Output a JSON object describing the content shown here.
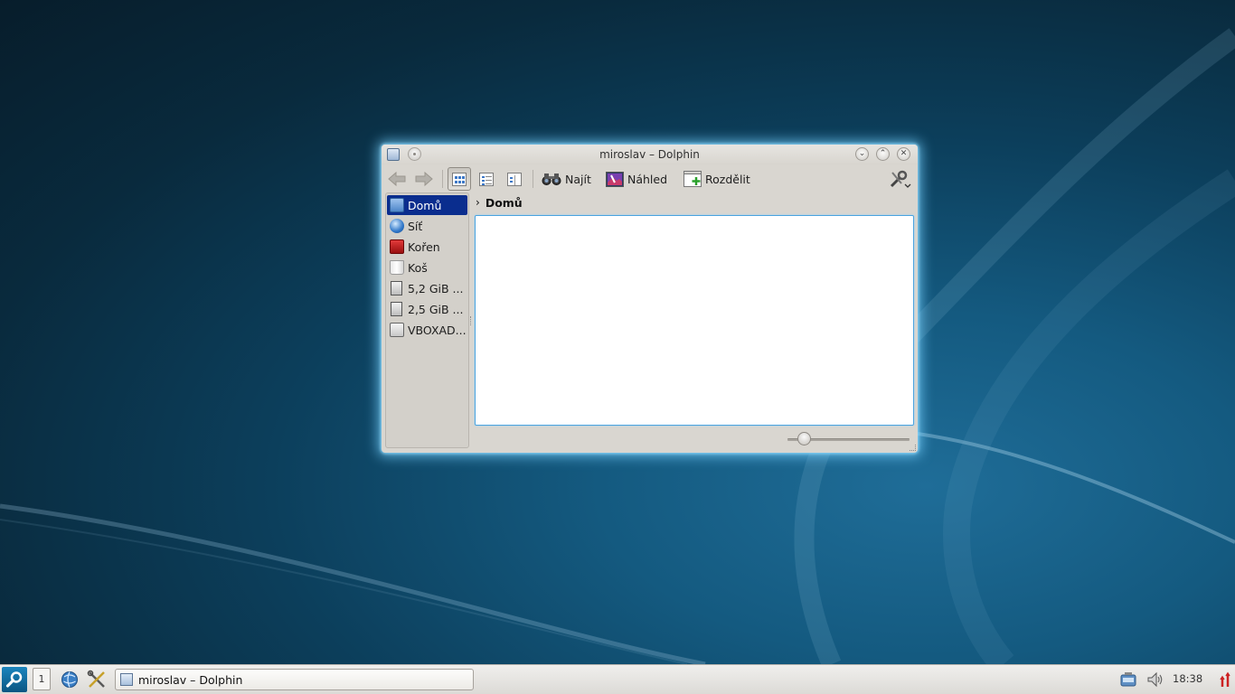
{
  "window": {
    "title": "miroslav – Dolphin",
    "buttons": {
      "minimize": "⌄",
      "maximize": "⌃",
      "close": "✕"
    }
  },
  "toolbar": {
    "back_icon": "arrow-left-icon",
    "forward_icon": "arrow-right-icon",
    "view_modes": [
      "icons-view-icon",
      "details-view-icon",
      "columns-view-icon"
    ],
    "active_view_mode": 0,
    "find_label": "Najít",
    "preview_label": "Náhled",
    "split_label": "Rozdělit",
    "settings_icon": "wrench-screwdriver-icon"
  },
  "places": [
    {
      "label": "Domů",
      "icon": "home-folder-icon",
      "selected": true
    },
    {
      "label": "Síť",
      "icon": "network-globe-icon",
      "selected": false
    },
    {
      "label": "Kořen",
      "icon": "root-folder-icon",
      "selected": false
    },
    {
      "label": "Koš",
      "icon": "trash-icon",
      "selected": false
    },
    {
      "label": "5,2 GiB ...",
      "icon": "hard-drive-icon",
      "selected": false
    },
    {
      "label": "2,5 GiB ...",
      "icon": "hard-drive-icon",
      "selected": false
    },
    {
      "label": "VBOXAD...",
      "icon": "optical-disc-icon",
      "selected": false
    }
  ],
  "breadcrumb": {
    "current": "Domů"
  },
  "zoom_level_fraction": 0.14,
  "taskbar": {
    "desktop_number": "1",
    "task_title": "miroslav – Dolphin",
    "clock": "18:38"
  },
  "colors": {
    "selection": "#0a2d8e",
    "window_glow": "#78d2ff",
    "desktop_dark": "#071d2b",
    "desktop_light": "#1f6d98"
  }
}
